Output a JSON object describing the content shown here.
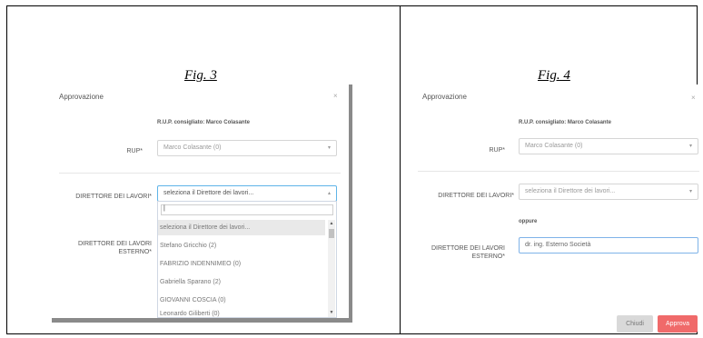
{
  "figures": {
    "fig3": "Fig. 3",
    "fig4": "Fig. 4"
  },
  "left_panel": {
    "title": "Approvazione",
    "close": "×",
    "rup_hint": "R.U.P. consigliato: Marco Colasante",
    "rup_label": "RUP*",
    "rup_value": "Marco Colasante (0)",
    "dl_label": "DIRETTORE DEI LAVORI*",
    "dl_value": "seleziona il Direttore dei lavori...",
    "dl_ext_label_1": "DIRETTORE DEI LAVORI",
    "dl_ext_label_2": "ESTERNO*",
    "search_value": "|",
    "options": [
      "seleziona il Direttore dei lavori...",
      "Stefano Gricchio (2)",
      "FABRIZIO INDENNIMEO (0)",
      "Gabriella Sparano (2)",
      "GIOVANNI COSCIA (0)",
      "Leonardo Giliberti (0)"
    ]
  },
  "right_panel": {
    "title": "Approvazione",
    "close": "×",
    "rup_hint": "R.U.P. consigliato: Marco Colasante",
    "rup_label": "RUP*",
    "rup_value": "Marco Colasante (0)",
    "dl_label": "DIRETTORE DEI LAVORI*",
    "dl_value": "seleziona il Direttore dei lavori...",
    "oppure": "oppure",
    "dl_ext_label_1": "DIRETTORE DEI LAVORI",
    "dl_ext_label_2": "ESTERNO*",
    "dl_ext_value": "dr. ing. Esterno Società",
    "btn_close": "Chiudi",
    "btn_approve": "Approva"
  },
  "icons": {
    "caret": "caret-down-icon",
    "close": "close-icon"
  },
  "colors": {
    "approve": "#f06a6a",
    "focus_border": "#5fb4e8"
  }
}
